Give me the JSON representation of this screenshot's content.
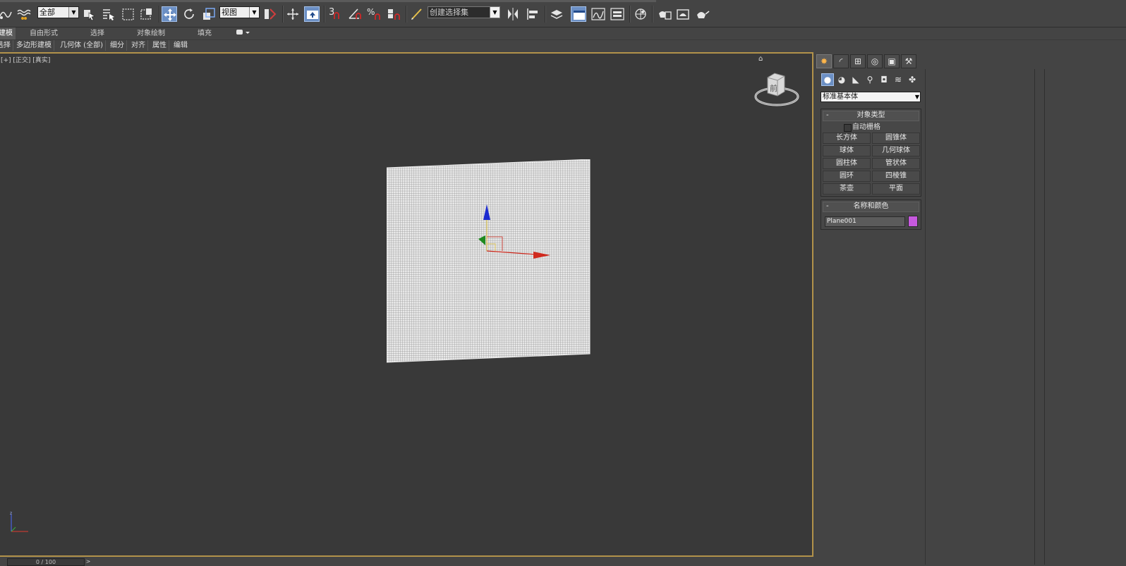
{
  "toolbar": {
    "selection_filter": "全部",
    "reference_coord": "视图",
    "named_selection_placeholder": "创建选择集",
    "snap_3d_label": "3",
    "icons": [
      "link-icon",
      "bind-spacewarp-icon",
      "select-object-icon",
      "select-by-name-icon",
      "rect-selection-icon",
      "window-crossing-icon",
      "select-move-icon",
      "select-rotate-icon",
      "select-scale-icon",
      "select-manipulate-icon",
      "keyboard-shortcut-icon",
      "snap-toggle-icon",
      "angle-snap-icon",
      "percent-snap-icon",
      "spinner-snap-icon",
      "edit-named-selection-icon",
      "mirror-icon",
      "align-icon",
      "layer-manager-icon",
      "graphite-toolbar-icon",
      "curve-editor-icon",
      "schematic-view-icon",
      "material-editor-icon",
      "render-setup-icon",
      "rendered-frame-icon",
      "render-production-icon"
    ]
  },
  "ribbon": {
    "tabs": [
      "建模",
      "自由形式",
      "选择",
      "对象绘制",
      "填充"
    ],
    "active_tab": "建模",
    "sub_items": [
      "选择",
      "多边形建模",
      "几何体 (全部)",
      "细分",
      "对齐",
      "属性",
      "编辑"
    ]
  },
  "viewport": {
    "label": "[+] [正交] [真实]",
    "viewcube_face": "前",
    "gizmo_colors": {
      "x": "#d02a1e",
      "y": "#1f8a1f",
      "z": "#1c2bd0"
    }
  },
  "command_panel": {
    "tabs": [
      "create-tab",
      "modify-tab",
      "hierarchy-tab",
      "motion-tab",
      "display-tab",
      "utilities-tab"
    ],
    "sub_icons": [
      "geometry-icon",
      "shapes-icon",
      "lights-icon",
      "cameras-icon",
      "helpers-icon",
      "spacewarps-icon",
      "systems-icon"
    ],
    "category": "标准基本体",
    "object_type": {
      "title": "对象类型",
      "autogrid": "自动栅格",
      "buttons": [
        "长方体",
        "圆锥体",
        "球体",
        "几何球体",
        "圆柱体",
        "管状体",
        "圆环",
        "四棱锥",
        "茶壶",
        "平面"
      ]
    },
    "name_color": {
      "title": "名称和颜色",
      "name": "Plane001",
      "color": "#c659de"
    }
  },
  "status": {
    "frame": "0 / 100",
    "next": ">"
  }
}
